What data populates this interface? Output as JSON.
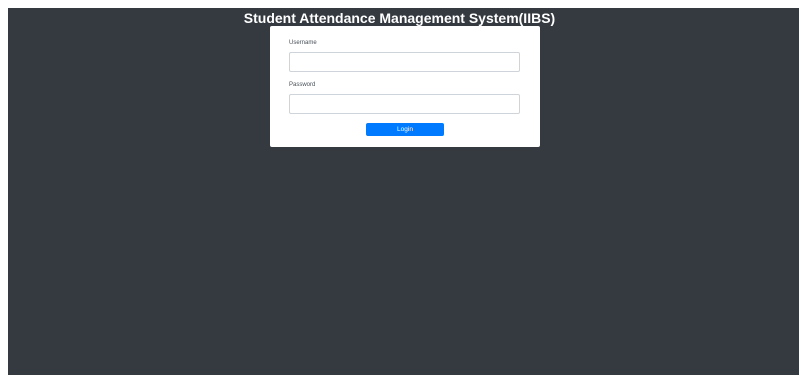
{
  "header": {
    "title": "Student Attendance Management System(IIBS)"
  },
  "login_form": {
    "username_label": "Username",
    "username_value": "",
    "password_label": "Password",
    "password_value": "",
    "login_button": "Login"
  },
  "colors": {
    "background": "#343a40",
    "card": "#ffffff",
    "primary_button": "#007bff",
    "title_text": "#ffffff"
  }
}
